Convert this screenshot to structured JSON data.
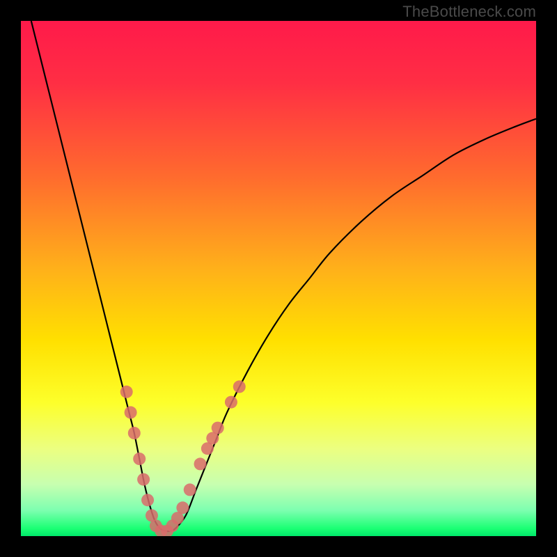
{
  "watermark": "TheBottleneck.com",
  "chart_data": {
    "type": "line",
    "title": "",
    "xlabel": "",
    "ylabel": "",
    "xlim": [
      0,
      100
    ],
    "ylim": [
      0,
      100
    ],
    "grid": false,
    "legend": false,
    "gradient_stops": [
      {
        "offset": 0.0,
        "color": "#ff1a4a"
      },
      {
        "offset": 0.12,
        "color": "#ff2e44"
      },
      {
        "offset": 0.3,
        "color": "#ff6a2e"
      },
      {
        "offset": 0.48,
        "color": "#ffb01a"
      },
      {
        "offset": 0.62,
        "color": "#ffe000"
      },
      {
        "offset": 0.74,
        "color": "#fdff2a"
      },
      {
        "offset": 0.83,
        "color": "#ecff80"
      },
      {
        "offset": 0.9,
        "color": "#c7ffb0"
      },
      {
        "offset": 0.95,
        "color": "#7dffb0"
      },
      {
        "offset": 0.985,
        "color": "#1bff74"
      },
      {
        "offset": 1.0,
        "color": "#00e86a"
      }
    ],
    "series": [
      {
        "name": "bottleneck-curve",
        "color": "#000000",
        "x": [
          2,
          4,
          6,
          8,
          10,
          12,
          14,
          16,
          18,
          20,
          21,
          22,
          23,
          24,
          25,
          26,
          27,
          28,
          29,
          30,
          32,
          34,
          36,
          38,
          40,
          44,
          48,
          52,
          56,
          60,
          66,
          72,
          78,
          84,
          90,
          96,
          100
        ],
        "y": [
          100,
          92,
          84,
          76,
          68,
          60,
          52,
          44,
          36,
          28,
          24,
          20,
          15,
          10,
          6,
          3,
          1.5,
          1,
          1,
          1.5,
          4,
          9,
          14,
          19,
          24,
          32,
          39,
          45,
          50,
          55,
          61,
          66,
          70,
          74,
          77,
          79.5,
          81
        ]
      }
    ],
    "markers": [
      {
        "name": "highlight-points",
        "color": "#d96b6b",
        "radius": 9,
        "points": [
          {
            "x": 20.5,
            "y": 28
          },
          {
            "x": 21.3,
            "y": 24
          },
          {
            "x": 22.0,
            "y": 20
          },
          {
            "x": 23.0,
            "y": 15
          },
          {
            "x": 23.8,
            "y": 11
          },
          {
            "x": 24.6,
            "y": 7
          },
          {
            "x": 25.4,
            "y": 4
          },
          {
            "x": 26.2,
            "y": 2
          },
          {
            "x": 27.2,
            "y": 1
          },
          {
            "x": 28.4,
            "y": 1
          },
          {
            "x": 29.4,
            "y": 2
          },
          {
            "x": 30.4,
            "y": 3.5
          },
          {
            "x": 31.4,
            "y": 5.5
          },
          {
            "x": 32.8,
            "y": 9
          },
          {
            "x": 34.8,
            "y": 14
          },
          {
            "x": 36.2,
            "y": 17
          },
          {
            "x": 37.2,
            "y": 19
          },
          {
            "x": 38.2,
            "y": 21
          },
          {
            "x": 40.8,
            "y": 26
          },
          {
            "x": 42.4,
            "y": 29
          }
        ]
      }
    ]
  }
}
